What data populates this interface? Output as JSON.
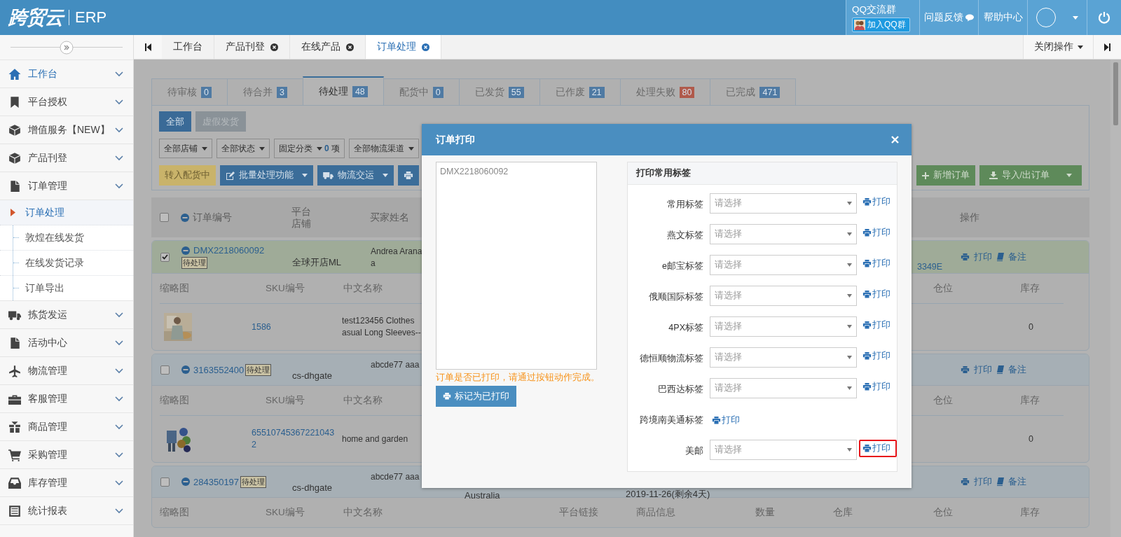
{
  "header": {
    "logo": "跨贸云",
    "product": "ERP",
    "qq_group": "QQ交流群",
    "qq_join": "加入QQ群",
    "feedback": "问题反馈",
    "help": "帮助中心"
  },
  "sidebar": {
    "items": [
      {
        "label": "工作台",
        "selected": true
      },
      {
        "label": "平台授权",
        "selected": false
      },
      {
        "label": "增值服务【NEW】",
        "selected": false
      },
      {
        "label": "产品刊登",
        "selected": false
      },
      {
        "label": "订单管理",
        "selected": false,
        "expanded": true,
        "children": [
          {
            "label": "订单处理",
            "selected": true
          },
          {
            "label": "敦煌在线发货",
            "selected": false
          },
          {
            "label": "在线发货记录",
            "selected": false
          },
          {
            "label": "订单导出",
            "selected": false
          }
        ]
      },
      {
        "label": "拣货发运",
        "selected": false
      },
      {
        "label": "活动中心",
        "selected": false
      },
      {
        "label": "物流管理",
        "selected": false
      },
      {
        "label": "客服管理",
        "selected": false
      },
      {
        "label": "商品管理",
        "selected": false
      },
      {
        "label": "采购管理",
        "selected": false
      },
      {
        "label": "库存管理",
        "selected": false
      },
      {
        "label": "统计报表",
        "selected": false
      }
    ]
  },
  "tabs": [
    {
      "label": "工作台",
      "closable": false,
      "selected": false
    },
    {
      "label": "产品刊登",
      "closable": true,
      "selected": false
    },
    {
      "label": "在线产品",
      "closable": true,
      "selected": false
    },
    {
      "label": "订单处理",
      "closable": true,
      "selected": true
    }
  ],
  "close_menu": "关闭操作",
  "status_tabs": [
    {
      "label": "待审核",
      "count": "0",
      "selected": false,
      "color": "#4f7aa3"
    },
    {
      "label": "待合并",
      "count": "3",
      "selected": false,
      "color": "#4f7aa3"
    },
    {
      "label": "待处理",
      "count": "48",
      "selected": true,
      "color": "#4f7aa3"
    },
    {
      "label": "配货中",
      "count": "0",
      "selected": false,
      "color": "#4f7aa3"
    },
    {
      "label": "已发货",
      "count": "55",
      "selected": false,
      "color": "#4f7aa3"
    },
    {
      "label": "已作废",
      "count": "21",
      "selected": false,
      "color": "#4f7aa3"
    },
    {
      "label": "处理失败",
      "count": "80",
      "selected": false,
      "color": "#b05a4b"
    },
    {
      "label": "已完成",
      "count": "471",
      "selected": false,
      "color": "#4f7aa3"
    }
  ],
  "quick_filters": [
    {
      "label": "全部",
      "selected": true
    },
    {
      "label": "虚假发货",
      "selected": false
    }
  ],
  "filters": [
    {
      "label": "全部店铺"
    },
    {
      "label": "全部状态"
    },
    {
      "label": "固定分类",
      "count": "0",
      "unit": "项"
    },
    {
      "label": "全部物流渠道"
    }
  ],
  "actions": [
    {
      "label": "转入配货中",
      "kind": "warning",
      "dropdown": false
    },
    {
      "label": "批量处理功能",
      "kind": "primary",
      "dropdown": true
    },
    {
      "label": "物流交运",
      "kind": "primary",
      "dropdown": true
    },
    {
      "kind": "primary",
      "dropdown": false
    }
  ],
  "right_actions": [
    {
      "label": "新增订单",
      "dropdown": false
    },
    {
      "label": "导入/出订单",
      "dropdown": true
    }
  ],
  "table": {
    "select_all": {
      "checked": false
    },
    "columns": {
      "order_no": "订单编号",
      "platform": "平台",
      "store": "店铺",
      "buyer": "买家姓名",
      "actions": "操作"
    },
    "orders": [
      {
        "checked": true,
        "order_no": "DMX2218060092",
        "status": "待处理",
        "store": "全球开店ML",
        "buyer": [
          "Andrea Arana",
          "a"
        ],
        "tracking": "3349E",
        "print": "打印",
        "note": "备注",
        "sub_left": [
          "缩略图",
          "SKU编号",
          "中文名称"
        ],
        "sub_right": [
          "仓位",
          "库存"
        ],
        "items": [
          {
            "sku": "1586",
            "name": [
              "test123456 Clothes",
              "asual Long Sleeves--"
            ],
            "stock": "0"
          }
        ]
      },
      {
        "checked": false,
        "order_no": "3163552400",
        "status": "待处理",
        "store": "cs-dhgate",
        "buyer": [
          "abcde77 aaa"
        ],
        "print": "打印",
        "note": "备注",
        "sub_left": [
          "缩略图",
          "SKU编号",
          "中文名称"
        ],
        "sub_right": [
          "仓位",
          "库存"
        ],
        "items": [
          {
            "sku": "655107453672210432",
            "name": [
              "home and garden"
            ],
            "stock": "0"
          }
        ]
      },
      {
        "checked": false,
        "order_no": "284350197",
        "status": "待处理",
        "store": "cs-dhgate",
        "buyer": [
          "abcde77 aaa"
        ],
        "country": "Australia",
        "date": "2019-11-26(剩余4天)",
        "print": "打印",
        "note": "备注",
        "sub_left": [
          "缩略图",
          "SKU编号",
          "中文名称",
          "平台链接",
          "商品信息",
          "数量",
          "仓库"
        ],
        "sub_right": [
          "仓位",
          "库存"
        ]
      }
    ]
  },
  "modal": {
    "title": "订单打印",
    "order_list": "DMX2218060092",
    "warning": "订单是否已打印，请通过按钮动作完成。",
    "mark_button": "标记为已打印",
    "panel_title": "打印常用标签",
    "rows": [
      {
        "label": "常用标签",
        "kind": "select",
        "placeholder": "请选择",
        "print": "打印",
        "highlighted": false
      },
      {
        "label": "燕文标签",
        "kind": "select",
        "placeholder": "请选择",
        "print": "打印",
        "highlighted": false
      },
      {
        "label": "e邮宝标签",
        "kind": "select",
        "placeholder": "请选择",
        "print": "打印",
        "highlighted": false
      },
      {
        "label": "俄顺国际标签",
        "kind": "select",
        "placeholder": "请选择",
        "print": "打印",
        "highlighted": false
      },
      {
        "label": "4PX标签",
        "kind": "select",
        "placeholder": "请选择",
        "print": "打印",
        "highlighted": false
      },
      {
        "label": "德恒顺物流标签",
        "kind": "select",
        "placeholder": "请选择",
        "print": "打印",
        "highlighted": false
      },
      {
        "label": "巴西达标签",
        "kind": "select",
        "placeholder": "请选择",
        "print": "打印",
        "highlighted": false
      },
      {
        "label": "跨境南美通标签",
        "kind": "link",
        "print": "打印",
        "highlighted": false
      },
      {
        "label": "美邮",
        "kind": "select",
        "placeholder": "请选择",
        "print": "打印",
        "highlighted": true
      }
    ]
  }
}
